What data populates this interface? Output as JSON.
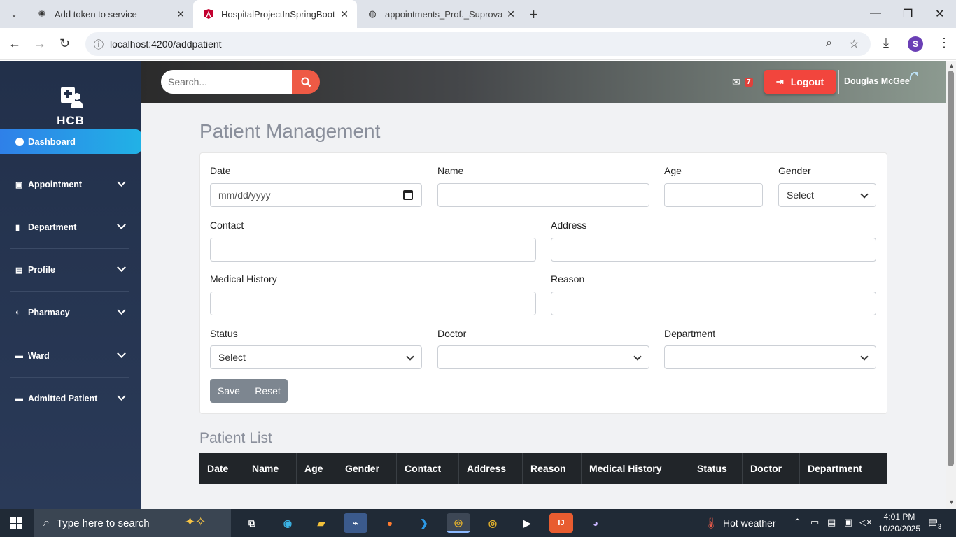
{
  "browser": {
    "tabs": [
      {
        "title": "Add token to service",
        "favicon": "chatgpt-icon"
      },
      {
        "title": "HospitalProjectInSpringBoot",
        "favicon": "angular-icon"
      },
      {
        "title": "appointments_Prof._Suprova_S",
        "favicon": "globe-icon"
      }
    ],
    "url": "localhost:4200/addpatient",
    "profile_initial": "S"
  },
  "sidebar": {
    "logo_text": "HCB",
    "dashboard_label": "Dashboard",
    "items": [
      {
        "label": "Appointment",
        "icon": "calendar-icon"
      },
      {
        "label": "Department",
        "icon": "building-icon"
      },
      {
        "label": "Profile",
        "icon": "id-card-icon"
      },
      {
        "label": "Pharmacy",
        "icon": "pills-icon"
      },
      {
        "label": "Ward",
        "icon": "bed-icon"
      },
      {
        "label": "Admitted Patient",
        "icon": "bed-icon"
      }
    ]
  },
  "header": {
    "search_placeholder": "Search...",
    "mail_count": "7",
    "logout_label": "Logout",
    "user_name": "Douglas McGee"
  },
  "page": {
    "title": "Patient Management",
    "form": {
      "date_label": "Date",
      "date_placeholder": "mm/dd/yyyy",
      "name_label": "Name",
      "age_label": "Age",
      "gender_label": "Gender",
      "gender_value": "Select",
      "contact_label": "Contact",
      "address_label": "Address",
      "medical_history_label": "Medical History",
      "reason_label": "Reason",
      "status_label": "Status",
      "status_value": "Select",
      "doctor_label": "Doctor",
      "department_label": "Department",
      "save_label": "Save",
      "reset_label": "Reset"
    },
    "list_title": "Patient List",
    "table_headers": [
      "Date",
      "Name",
      "Age",
      "Gender",
      "Contact",
      "Address",
      "Reason",
      "Medical History",
      "Status",
      "Doctor",
      "Department"
    ]
  },
  "taskbar": {
    "search_placeholder": "Type here to search",
    "weather": "Hot weather",
    "time": "4:01 PM",
    "date": "10/20/2025",
    "notification_count": "3"
  },
  "colors": {
    "sidebar_bg": "#22304a",
    "dashboard_accent": "#21b2e6",
    "logout_bg": "#f2453d",
    "search_btn_bg": "#ee5a45",
    "table_header_bg": "#212529",
    "button_bg": "#7d8690"
  }
}
